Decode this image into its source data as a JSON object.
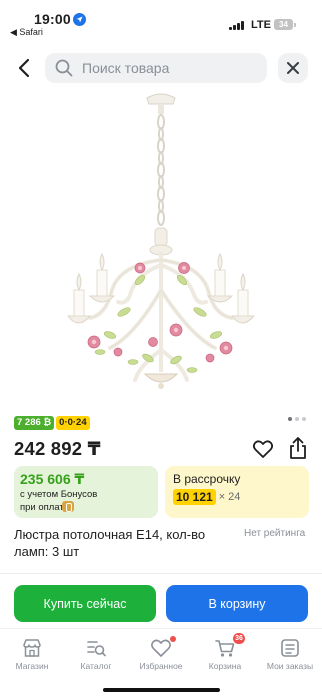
{
  "status_bar": {
    "time": "19:00",
    "back_app": "◀ Safari",
    "network": "LTE",
    "battery": "34"
  },
  "search": {
    "placeholder": "Поиск товара"
  },
  "product": {
    "badge_bonus": "7 286 ₿",
    "badge_installment": "0·0·24",
    "price": "242 892 ₸",
    "title": "Люстра потолочная E14, кол-во ламп: 3 шт",
    "rating": "Нет рейтинга"
  },
  "bonus_card": {
    "amount": "235 606 ₸",
    "line1": "с учетом Бонусов",
    "line2": "при оплате"
  },
  "installment_card": {
    "title": "В рассрочку",
    "amount": "10 121",
    "multiplier": "× 24"
  },
  "actions": {
    "buy_now": "Купить сейчас",
    "add_to_cart": "В корзину"
  },
  "tabbar": {
    "items": [
      {
        "label": "Магазин",
        "icon": "store-icon"
      },
      {
        "label": "Каталог",
        "icon": "catalog-icon"
      },
      {
        "label": "Избранное",
        "icon": "heart-icon"
      },
      {
        "label": "Корзина",
        "icon": "cart-icon",
        "badge": "36"
      },
      {
        "label": "Мои заказы",
        "icon": "orders-icon"
      }
    ]
  },
  "colors": {
    "green": "#1db13b",
    "blue": "#1e73e8",
    "yellow": "#ffd200",
    "red_badge": "#f04e4e"
  }
}
